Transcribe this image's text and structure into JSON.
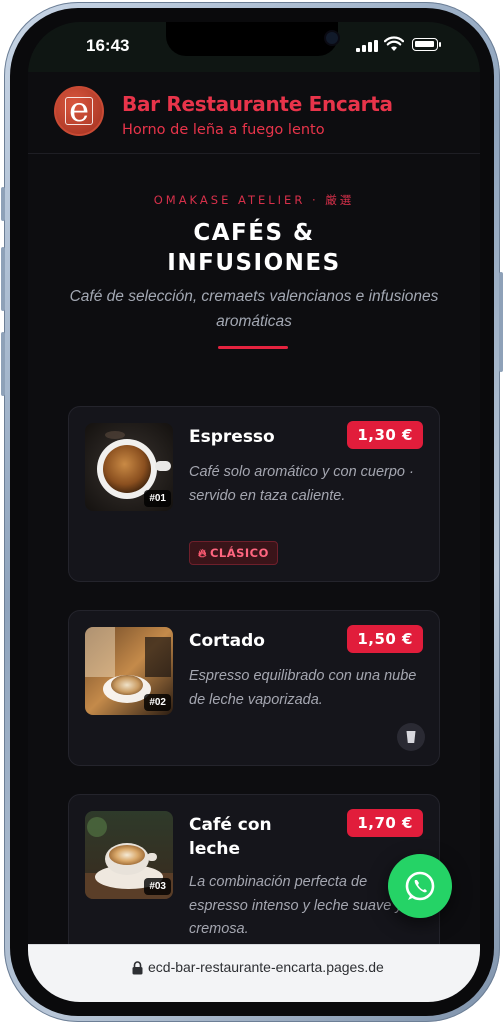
{
  "status_bar": {
    "time": "16:43"
  },
  "header": {
    "logo_letter": "e",
    "brand_name": "Bar Restaurante Encarta",
    "tagline": "Horno de leña a fuego lento"
  },
  "hero": {
    "kicker": "OMAKASE ATELIER · 厳選",
    "title_line1": "CAFÉS &",
    "title_line2": "INFUSIONES",
    "subtitle": "Café de selección, cremaets valencianos e infusiones aromáticas"
  },
  "menu_items": [
    {
      "number": "#01",
      "name": "Espresso",
      "price": "1,30 €",
      "description": "Café solo aromático y con cuerpo · servido en taza caliente.",
      "badge": "CLÁSICO",
      "badge_icon": "flame-icon"
    },
    {
      "number": "#02",
      "name": "Cortado",
      "price": "1,50 €",
      "description": "Espresso equilibrado con una nube de leche vaporizada.",
      "action_icon": "cup-icon"
    },
    {
      "number": "#03",
      "name": "Café con leche",
      "price": "1,70 €",
      "description": "La combinación perfecta de espresso intenso y leche suave y cremosa."
    }
  ],
  "whatsapp": {
    "icon": "whatsapp-icon"
  },
  "browser": {
    "url": "ecd-bar-restaurante-encarta.pages.de"
  },
  "colors": {
    "accent": "#e11d3b",
    "background": "#0d0d10",
    "card": "#15151b",
    "whatsapp": "#25d366"
  }
}
